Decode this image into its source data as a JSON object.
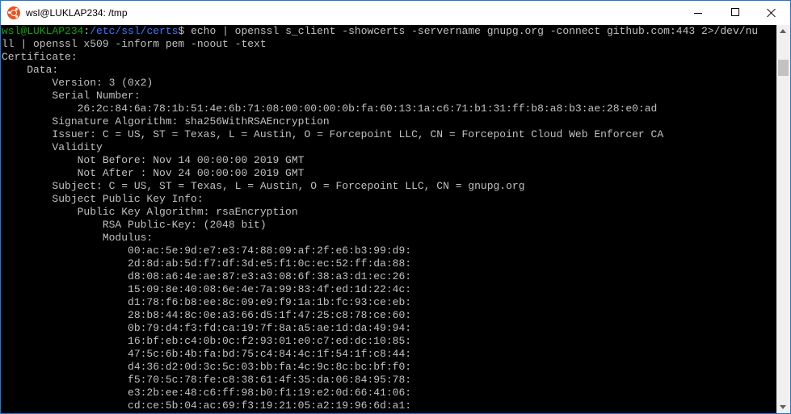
{
  "window": {
    "title": "wsl@LUKLAP234: /tmp",
    "app_icon": "ubuntu-icon",
    "controls": {
      "minimize_icon": "minimize-icon",
      "maximize_icon": "maximize-icon",
      "close_icon": "close-icon"
    }
  },
  "terminal": {
    "prompt": {
      "user_host": "wsl@LUKLAP234",
      "separator": ":",
      "path": "/etc/ssl/certs",
      "symbol": "$",
      "command_line1": " echo | openssl s_client -showcerts -servername gnupg.org -connect github.com:443 2>/dev/nu",
      "command_line2": "ll | openssl x509 -inform pem -noout -text"
    },
    "output": [
      "Certificate:",
      "    Data:",
      "        Version: 3 (0x2)",
      "        Serial Number:",
      "            26:2c:84:6a:78:1b:51:4e:6b:71:08:00:00:00:0b:fa:60:13:1a:c6:71:b1:31:ff:b8:a8:b3:ae:28:e0:ad",
      "        Signature Algorithm: sha256WithRSAEncryption",
      "        Issuer: C = US, ST = Texas, L = Austin, O = Forcepoint LLC, CN = Forcepoint Cloud Web Enforcer CA",
      "        Validity",
      "            Not Before: Nov 14 00:00:00 2019 GMT",
      "            Not After : Nov 24 00:00:00 2019 GMT",
      "        Subject: C = US, ST = Texas, L = Austin, O = Forcepoint LLC, CN = gnupg.org",
      "        Subject Public Key Info:",
      "            Public Key Algorithm: rsaEncryption",
      "                RSA Public-Key: (2048 bit)",
      "                Modulus:",
      "                    00:ac:5e:9d:e7:e3:74:88:09:af:2f:e6:b3:99:d9:",
      "                    2d:8d:ab:5d:f7:df:3d:e5:f1:0c:ec:52:ff:da:88:",
      "                    d8:08:a6:4e:ae:87:e3:a3:08:6f:38:a3:d1:ec:26:",
      "                    15:09:8e:40:08:6e:4e:7a:99:83:4f:ed:1d:22:4c:",
      "                    d1:78:f6:b8:ee:8c:09:e9:f9:1a:1b:fc:93:ce:eb:",
      "                    28:b8:44:8c:0e:a3:66:d5:1f:47:25:c8:78:ce:60:",
      "                    0b:79:d4:f3:fd:ca:19:7f:8a:a5:ae:1d:da:49:94:",
      "                    16:bf:eb:c4:0b:0c:f2:93:01:e0:c7:ed:dc:10:85:",
      "                    47:5c:6b:4b:fa:bd:75:c4:84:4c:1f:54:1f:c8:44:",
      "                    d4:36:d2:0d:3c:5c:03:bb:fa:4c:9c:8c:bc:bf:f0:",
      "                    f5:70:5c:78:fe:c8:38:61:4f:35:da:06:84:95:78:",
      "                    e3:2b:ee:48:c6:ff:98:b0:f1:19:e2:0d:66:41:06:",
      "                    cd:ce:5b:04:ac:69:f3:19:21:05:a2:19:96:6d:a1:"
    ]
  },
  "colors": {
    "prompt_user": "#13a10e",
    "prompt_path": "#3b78ff",
    "text": "#c0c0c0",
    "background": "#000000"
  }
}
